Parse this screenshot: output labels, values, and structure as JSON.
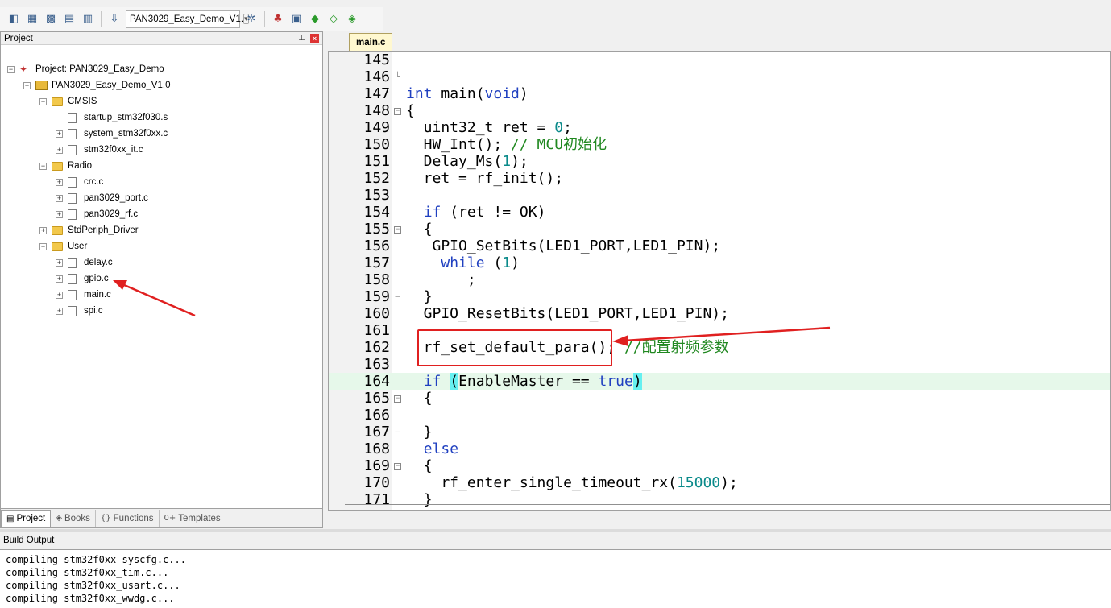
{
  "toolbar": {
    "target_name": "PAN3029_Easy_Demo_V1."
  },
  "project_panel": {
    "title": "Project",
    "tree": [
      {
        "label": "Project: PAN3029_Easy_Demo",
        "kind": "project",
        "expander": "−",
        "indent": 0
      },
      {
        "label": "PAN3029_Easy_Demo_V1.0",
        "kind": "target",
        "expander": "−",
        "indent": 1
      },
      {
        "label": "CMSIS",
        "kind": "folder",
        "expander": "−",
        "indent": 2
      },
      {
        "label": "startup_stm32f030.s",
        "kind": "file",
        "expander": "",
        "indent": 3
      },
      {
        "label": "system_stm32f0xx.c",
        "kind": "file",
        "expander": "+",
        "indent": 3
      },
      {
        "label": "stm32f0xx_it.c",
        "kind": "file",
        "expander": "+",
        "indent": 3
      },
      {
        "label": "Radio",
        "kind": "folder",
        "expander": "−",
        "indent": 2
      },
      {
        "label": "crc.c",
        "kind": "file",
        "expander": "+",
        "indent": 3
      },
      {
        "label": "pan3029_port.c",
        "kind": "file",
        "expander": "+",
        "indent": 3
      },
      {
        "label": "pan3029_rf.c",
        "kind": "file",
        "expander": "+",
        "indent": 3
      },
      {
        "label": "StdPeriph_Driver",
        "kind": "folder",
        "expander": "+",
        "indent": 2
      },
      {
        "label": "User",
        "kind": "folder",
        "expander": "−",
        "indent": 2
      },
      {
        "label": "delay.c",
        "kind": "file",
        "expander": "+",
        "indent": 3
      },
      {
        "label": "gpio.c",
        "kind": "file",
        "expander": "+",
        "indent": 3
      },
      {
        "label": "main.c",
        "kind": "file",
        "expander": "+",
        "indent": 3
      },
      {
        "label": "spi.c",
        "kind": "file",
        "expander": "+",
        "indent": 3
      }
    ],
    "tabs": [
      {
        "label": "Project",
        "icon": "project-icon",
        "glyph": "▤",
        "active": true
      },
      {
        "label": "Books",
        "icon": "books-icon",
        "glyph": "◈",
        "active": false
      },
      {
        "label": "Functions",
        "icon": "functions-icon",
        "glyph": "{}",
        "active": false
      },
      {
        "label": "Templates",
        "icon": "templates-icon",
        "glyph": "0+",
        "active": false
      }
    ]
  },
  "editor": {
    "active_tab": "main.c",
    "highlighted_line": "164",
    "lines": [
      {
        "n": "145",
        "fold": "",
        "code": []
      },
      {
        "n": "146",
        "fold": "",
        "code": []
      },
      {
        "n": "147",
        "fold": "",
        "code": [
          [
            "kw",
            "int"
          ],
          [
            "p",
            " main("
          ],
          [
            "kw",
            "void"
          ],
          [
            "p",
            ")"
          ]
        ]
      },
      {
        "n": "148",
        "fold": "box",
        "code": [
          [
            "p",
            "{"
          ]
        ]
      },
      {
        "n": "149",
        "fold": "",
        "code": [
          [
            "p",
            "  uint32_t ret = "
          ],
          [
            "num",
            "0"
          ],
          [
            "p",
            ";"
          ]
        ]
      },
      {
        "n": "150",
        "fold": "",
        "code": [
          [
            "p",
            "  HW_Int(); "
          ],
          [
            "cm",
            "// MCU初始化"
          ]
        ]
      },
      {
        "n": "151",
        "fold": "",
        "code": [
          [
            "p",
            "  Delay_Ms("
          ],
          [
            "num",
            "1"
          ],
          [
            "p",
            ");"
          ]
        ]
      },
      {
        "n": "152",
        "fold": "",
        "code": [
          [
            "p",
            "  ret = rf_init();"
          ]
        ]
      },
      {
        "n": "153",
        "fold": "",
        "code": []
      },
      {
        "n": "154",
        "fold": "",
        "code": [
          [
            "p",
            "  "
          ],
          [
            "kw",
            "if"
          ],
          [
            "p",
            " (ret != OK)"
          ]
        ]
      },
      {
        "n": "155",
        "fold": "box",
        "code": [
          [
            "p",
            "  {"
          ]
        ]
      },
      {
        "n": "156",
        "fold": "",
        "code": [
          [
            "p",
            "   GPIO_SetBits(LED1_PORT,LED1_PIN);"
          ]
        ]
      },
      {
        "n": "157",
        "fold": "",
        "code": [
          [
            "p",
            "    "
          ],
          [
            "kw",
            "while"
          ],
          [
            "p",
            " ("
          ],
          [
            "num",
            "1"
          ],
          [
            "p",
            ")"
          ]
        ]
      },
      {
        "n": "158",
        "fold": "",
        "code": [
          [
            "p",
            "       ;"
          ]
        ]
      },
      {
        "n": "159",
        "fold": "end",
        "code": [
          [
            "p",
            "  }"
          ]
        ]
      },
      {
        "n": "160",
        "fold": "",
        "code": [
          [
            "p",
            "  GPIO_ResetBits(LED1_PORT,LED1_PIN);"
          ]
        ]
      },
      {
        "n": "161",
        "fold": "",
        "code": []
      },
      {
        "n": "162",
        "fold": "",
        "code": [
          [
            "p",
            "  rf_set_default_para(); "
          ],
          [
            "cm",
            "//配置射频参数"
          ]
        ]
      },
      {
        "n": "163",
        "fold": "",
        "code": []
      },
      {
        "n": "164",
        "fold": "",
        "code": [
          [
            "p",
            "  "
          ],
          [
            "kw",
            "if"
          ],
          [
            "p",
            " "
          ],
          [
            "brk",
            "("
          ],
          [
            "p",
            "EnableMaster == "
          ],
          [
            "kw",
            "true"
          ],
          [
            "brk",
            ")"
          ]
        ]
      },
      {
        "n": "165",
        "fold": "box",
        "code": [
          [
            "p",
            "  {"
          ]
        ]
      },
      {
        "n": "166",
        "fold": "",
        "code": []
      },
      {
        "n": "167",
        "fold": "end",
        "code": [
          [
            "p",
            "  }"
          ]
        ]
      },
      {
        "n": "168",
        "fold": "",
        "code": [
          [
            "p",
            "  "
          ],
          [
            "kw",
            "else"
          ]
        ]
      },
      {
        "n": "169",
        "fold": "box",
        "code": [
          [
            "p",
            "  {"
          ]
        ]
      },
      {
        "n": "170",
        "fold": "",
        "code": [
          [
            "p",
            "    rf_enter_single_timeout_rx("
          ],
          [
            "num",
            "15000"
          ],
          [
            "p",
            ");"
          ]
        ]
      },
      {
        "n": "171",
        "fold": "",
        "code": [
          [
            "p",
            "  }"
          ]
        ]
      }
    ]
  },
  "build_output": {
    "title": "Build Output",
    "lines": [
      "compiling stm32f0xx_syscfg.c...",
      "compiling stm32f0xx_tim.c...",
      "compiling stm32f0xx_usart.c...",
      "compiling stm32f0xx_wwdg.c..."
    ]
  },
  "colors": {
    "keyword": "#2040c0",
    "number": "#0a8a8a",
    "comment": "#208820",
    "annotation": "#e02020",
    "highlight_line": "#e6f8ea"
  }
}
